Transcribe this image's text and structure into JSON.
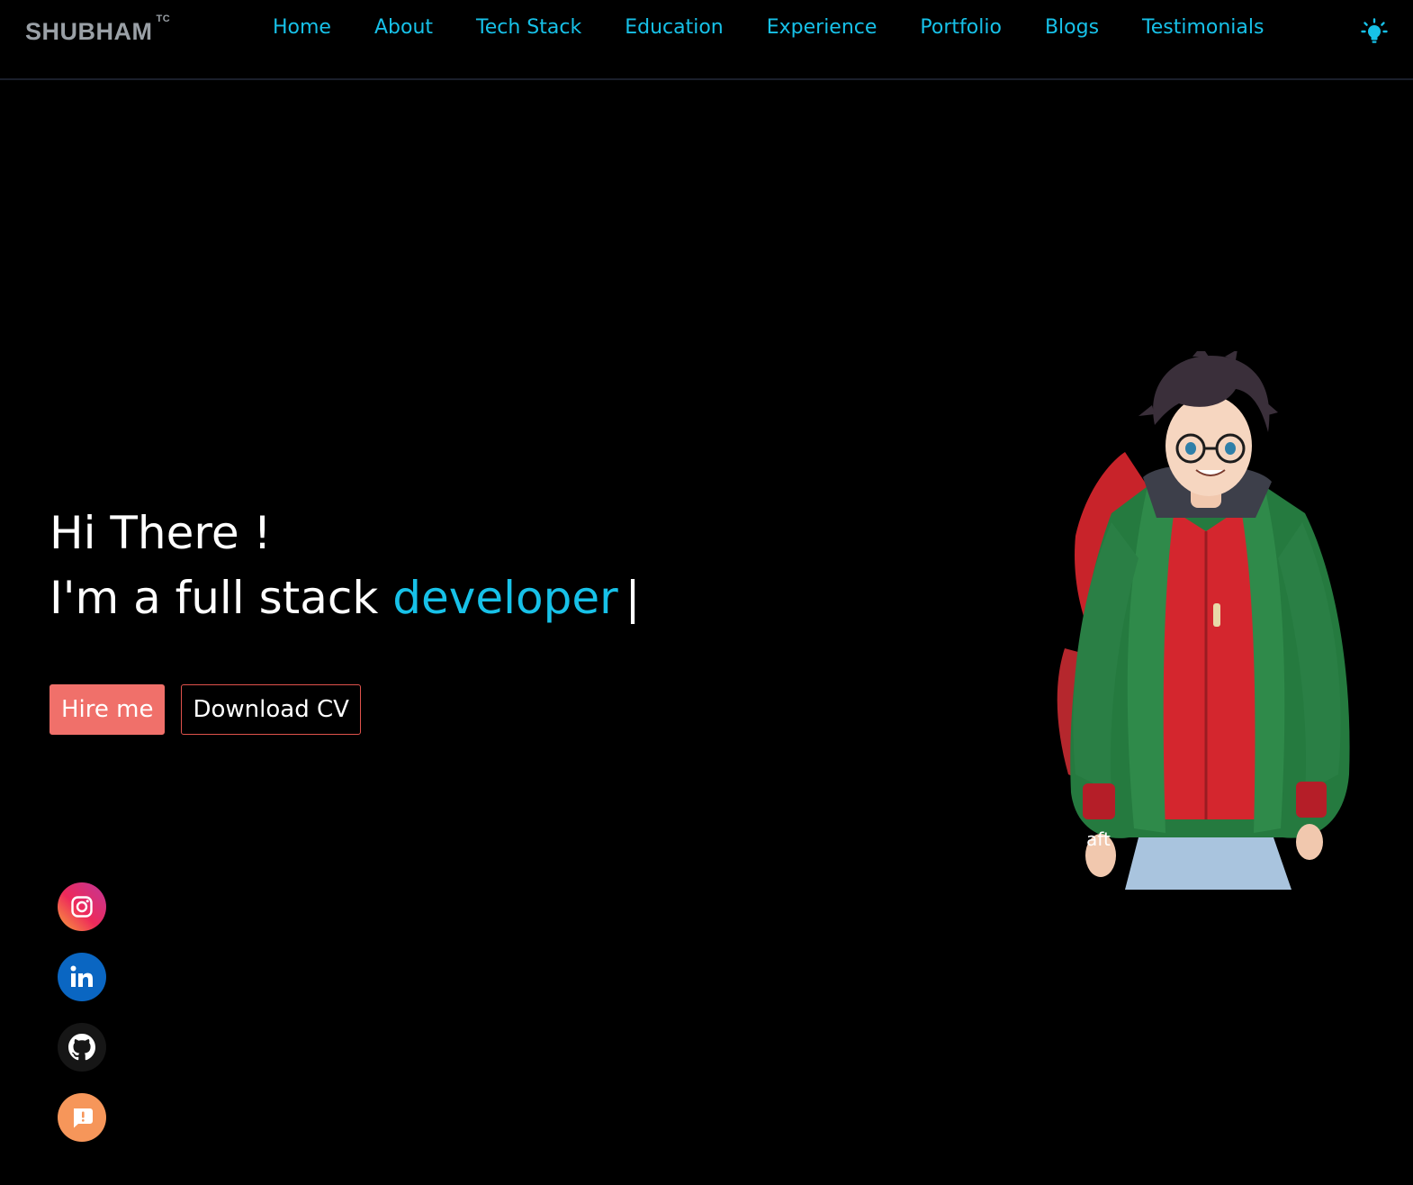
{
  "brand": {
    "name": "SHUBHAM",
    "mark": "TC"
  },
  "nav": {
    "items": [
      {
        "label": "Home"
      },
      {
        "label": "About"
      },
      {
        "label": "Tech Stack"
      },
      {
        "label": "Education"
      },
      {
        "label": "Experience"
      },
      {
        "label": "Portfolio"
      },
      {
        "label": "Blogs"
      },
      {
        "label": "Testimonials"
      }
    ],
    "theme_icon": "lightbulb-icon"
  },
  "hero": {
    "greeting": "Hi There !",
    "intro_prefix": "I'm a full stack",
    "intro_role": "developer",
    "cursor": "|"
  },
  "buttons": {
    "hire": "Hire me",
    "cv": "Download CV"
  },
  "social": {
    "icons": [
      "instagram-icon",
      "linkedin-icon",
      "github-icon",
      "chat-icon"
    ]
  },
  "avatar": {
    "watermark": "aft"
  },
  "colors": {
    "accent": "#17c1e8",
    "hire_button": "#f0706a",
    "background": "#000000",
    "brand_text": "#9aa0a6"
  }
}
